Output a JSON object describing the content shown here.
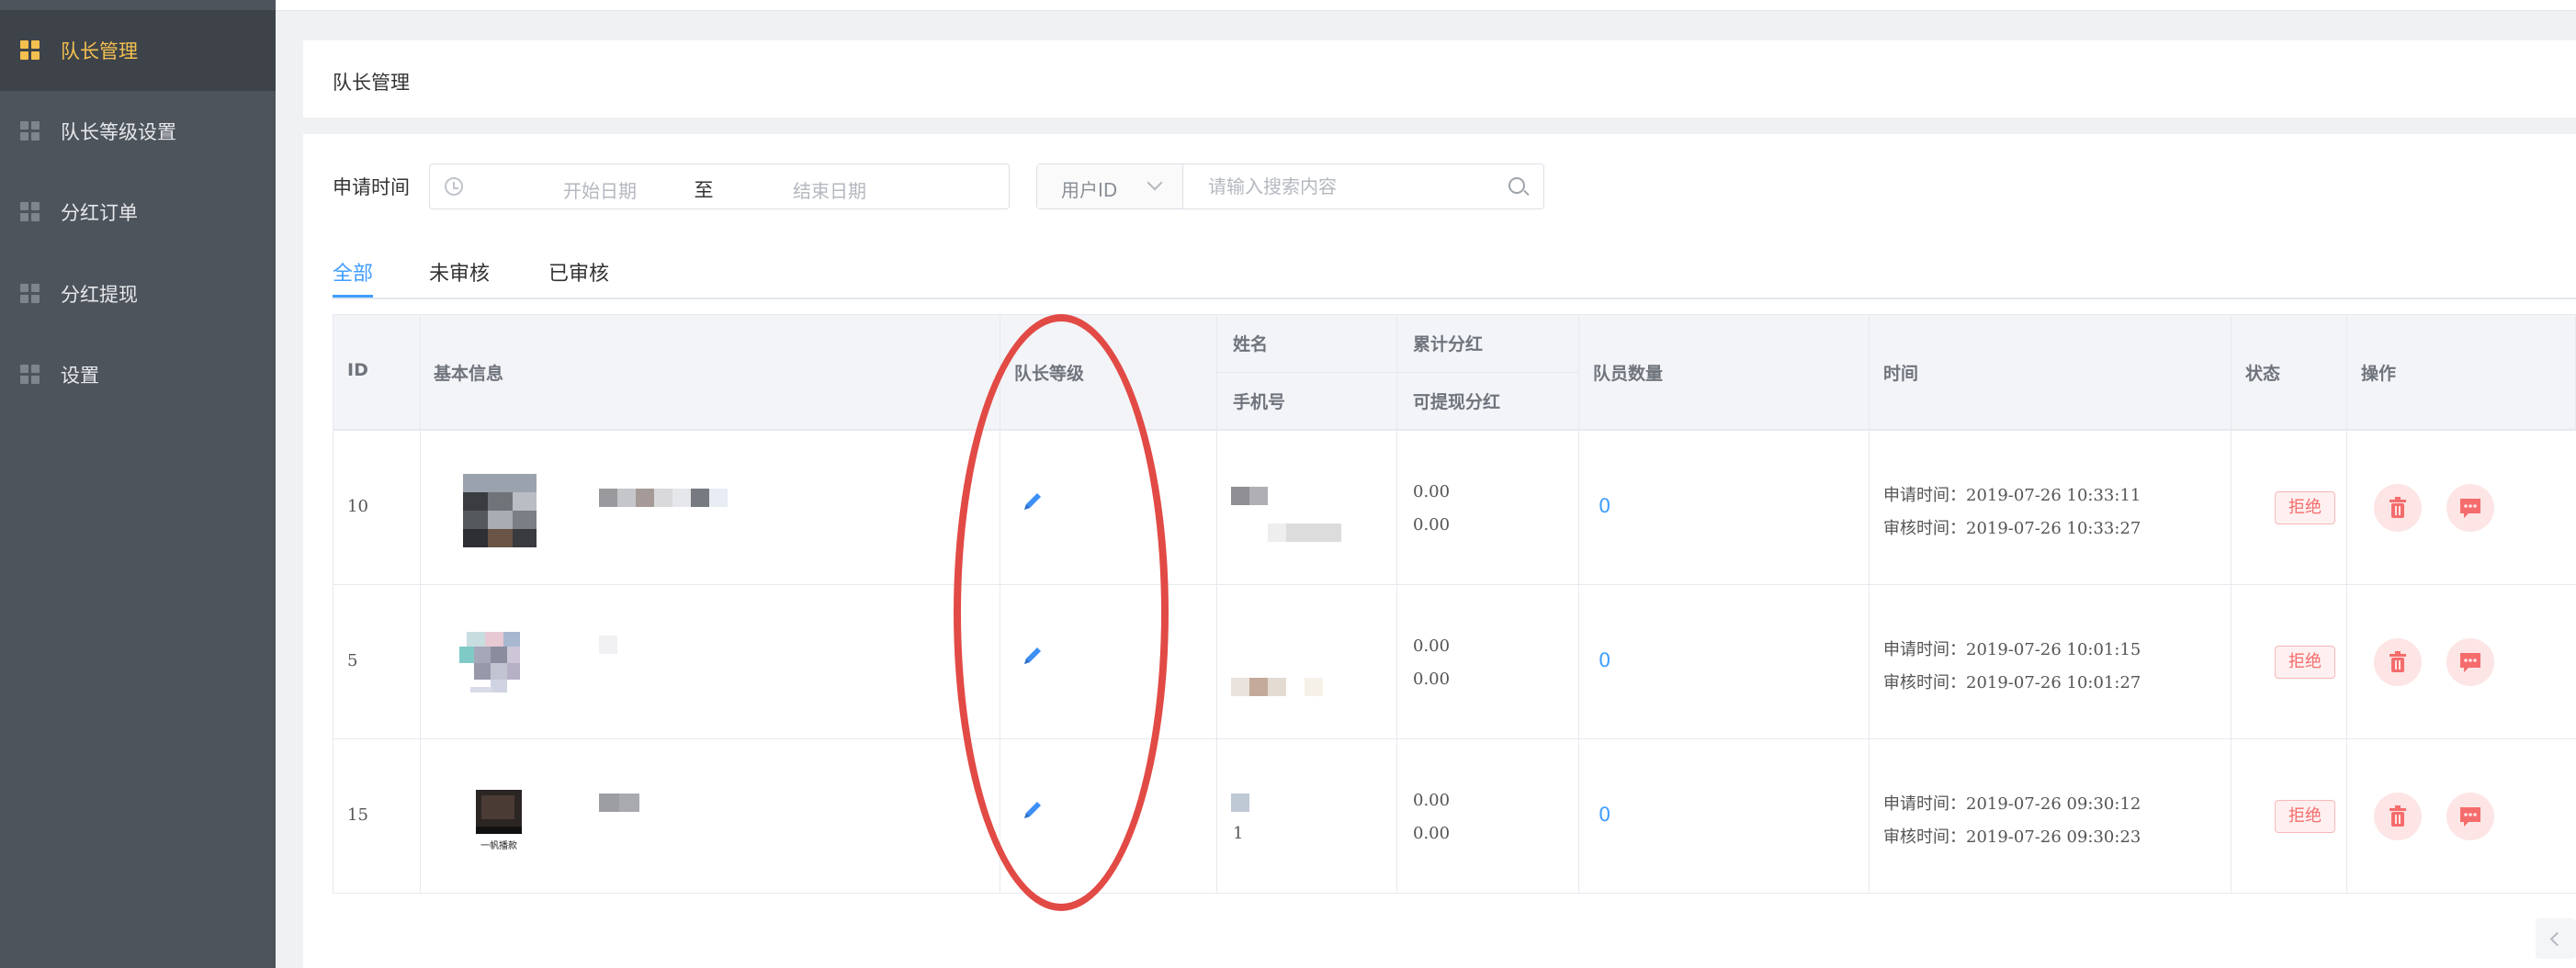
{
  "sidebar": {
    "items": [
      {
        "label": "队长管理",
        "active": true
      },
      {
        "label": "队长等级设置",
        "active": false
      },
      {
        "label": "分红订单",
        "active": false
      },
      {
        "label": "分红提现",
        "active": false
      },
      {
        "label": "设置",
        "active": false
      }
    ]
  },
  "page": {
    "title": "队长管理"
  },
  "filter": {
    "label": "申请时间",
    "start_placeholder": "开始日期",
    "separator": "至",
    "end_placeholder": "结束日期",
    "search_field": "用户ID",
    "search_placeholder": "请输入搜索内容"
  },
  "tabs": [
    {
      "label": "全部",
      "active": true
    },
    {
      "label": "未审核",
      "active": false
    },
    {
      "label": "已审核",
      "active": false
    }
  ],
  "table": {
    "headers": {
      "id": "ID",
      "basic": "基本信息",
      "level": "队长等级",
      "name": "姓名",
      "phone": "手机号",
      "total_bonus": "累计分红",
      "withdrawable": "可提现分红",
      "members": "队员数量",
      "time": "时间",
      "status": "状态",
      "ops": "操作"
    },
    "rows": [
      {
        "id": "10",
        "total_bonus": "0.00",
        "withdrawable": "0.00",
        "members": "0",
        "apply_time": "申请时间：2019-07-26 10:33:11",
        "review_time": "审核时间：2019-07-26 10:33:27",
        "status": "拒绝"
      },
      {
        "id": "5",
        "total_bonus": "0.00",
        "withdrawable": "0.00",
        "members": "0",
        "apply_time": "申请时间：2019-07-26 10:01:15",
        "review_time": "审核时间：2019-07-26 10:01:27",
        "status": "拒绝"
      },
      {
        "id": "15",
        "total_bonus": "0.00",
        "withdrawable": "0.00",
        "members": "0",
        "apply_time": "申请时间：2019-07-26 09:30:12",
        "review_time": "审核时间：2019-07-26 09:30:23",
        "status": "拒绝",
        "phone_partial": "1",
        "thumb_caption": "一帆播款"
      }
    ]
  },
  "colors": {
    "sidebar_bg": "#4e545c",
    "sidebar_active": "#f3c04f",
    "primary": "#409eff",
    "danger": "#f56c6c",
    "annotation": "#e24a45"
  }
}
